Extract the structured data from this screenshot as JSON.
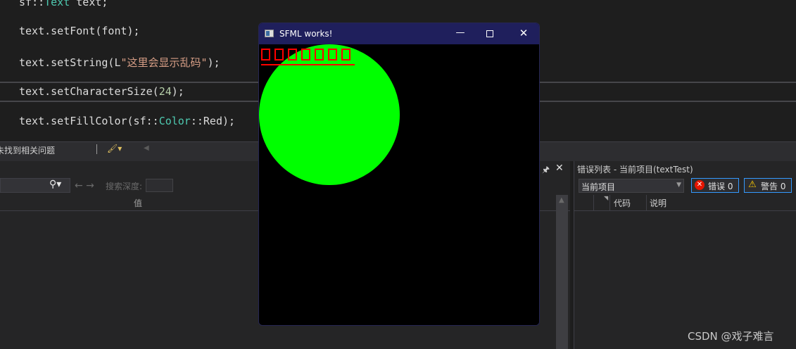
{
  "editor": {
    "lines": [
      {
        "obj": "sf",
        "sep": "::",
        "type": "Text",
        "rest": " text;"
      },
      {
        "obj": "text",
        "call": ".setFont(font);"
      },
      {
        "obj": "text",
        "call": ".setString(L",
        "str": "\"这里会显示乱码\"",
        "end": ");"
      },
      {
        "obj": "text",
        "call": ".setCharacterSize(",
        "num": "24",
        "end": ");"
      },
      {
        "obj": "text",
        "call": ".setFillColor(sf::",
        "type": "Color",
        "mid": "::Red);"
      }
    ]
  },
  "statusbar": {
    "issues_text": "未找到相关问题"
  },
  "left_panel": {
    "depth_label": "搜索深度:",
    "value_header": "值",
    "pin_icon": "pin-icon",
    "close_icon": "close-icon"
  },
  "error_list": {
    "title": "错误列表 - 当前项目(textTest)",
    "scope": "当前项目",
    "errors_label": "错误 0",
    "warnings_label": "警告 0",
    "col_code": "代码",
    "col_desc": "说明"
  },
  "sfml_window": {
    "title": "SFML works!",
    "box_count": 7,
    "text_color": "#ff0000",
    "circle_color": "#00ff00"
  },
  "watermark": "CSDN @戏子难言"
}
